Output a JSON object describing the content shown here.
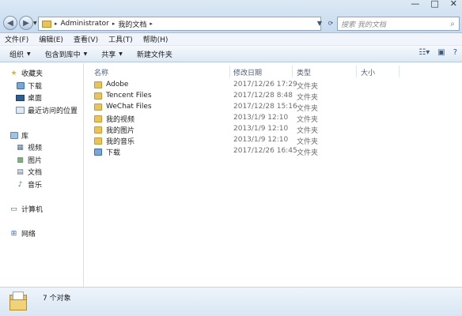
{
  "window": {
    "controls": [
      "—",
      "□",
      "✕"
    ]
  },
  "address": {
    "segments": [
      "Administrator",
      "我的文档"
    ],
    "separator": "▸"
  },
  "search": {
    "placeholder": "搜索 我的文档"
  },
  "menu": [
    "文件(F)",
    "编辑(E)",
    "查看(V)",
    "工具(T)",
    "帮助(H)"
  ],
  "toolbar": {
    "organize": "组织",
    "include_in_library": "包含到库中",
    "share": "共享",
    "new_folder": "新建文件夹",
    "caret": "▼"
  },
  "sidebar": {
    "favorites": {
      "header": "收藏夹",
      "items": [
        "下载",
        "桌面",
        "最近访问的位置"
      ]
    },
    "libraries": {
      "header": "库",
      "items": [
        "视频",
        "图片",
        "文档",
        "音乐"
      ]
    },
    "computer": "计算机",
    "network": "网络"
  },
  "columns": {
    "name": "名称",
    "modified": "修改日期",
    "type": "类型",
    "size": "大小"
  },
  "files": [
    {
      "name": "Adobe",
      "modified": "2017/12/26 17:29",
      "type": "文件夹",
      "icon": "folder"
    },
    {
      "name": "Tencent Files",
      "modified": "2017/12/28 8:48",
      "type": "文件夹",
      "icon": "folder"
    },
    {
      "name": "WeChat Files",
      "modified": "2017/12/28 15:16",
      "type": "文件夹",
      "icon": "folder"
    },
    {
      "name": "我的视频",
      "modified": "2013/1/9 12:10",
      "type": "文件夹",
      "icon": "videos-folder"
    },
    {
      "name": "我的图片",
      "modified": "2013/1/9 12:10",
      "type": "文件夹",
      "icon": "pictures-folder"
    },
    {
      "name": "我的音乐",
      "modified": "2013/1/9 12:10",
      "type": "文件夹",
      "icon": "music-folder"
    },
    {
      "name": "下载",
      "modified": "2017/12/26 16:45",
      "type": "文件夹",
      "icon": "downloads-folder"
    }
  ],
  "status": {
    "count_text": "7 个对象"
  },
  "colors": {
    "folder": "#e9c45b",
    "frame": "#c7daee",
    "selection_accent": "#3d6fa8"
  }
}
